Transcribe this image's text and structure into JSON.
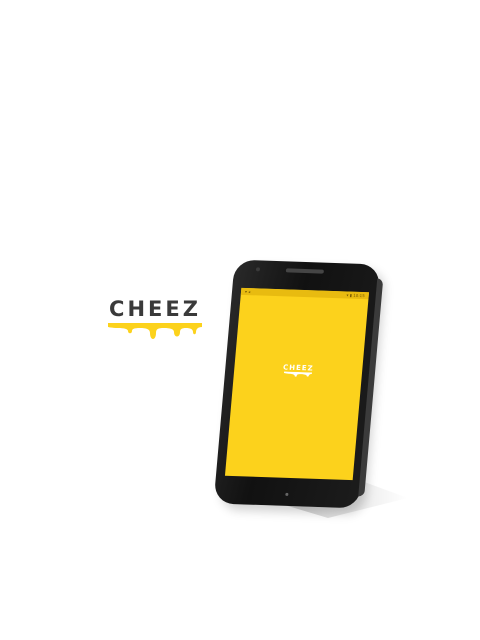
{
  "logo": {
    "text": "CHEEZ",
    "drip_color": "#fcd21c",
    "text_color": "#3a3a3a"
  },
  "phone": {
    "screen_color": "#fcd21c",
    "status_left": "▾ ◂",
    "status_right": "▾ ▮ 10:15",
    "screen_logo": {
      "text": "CHEEZ"
    }
  }
}
